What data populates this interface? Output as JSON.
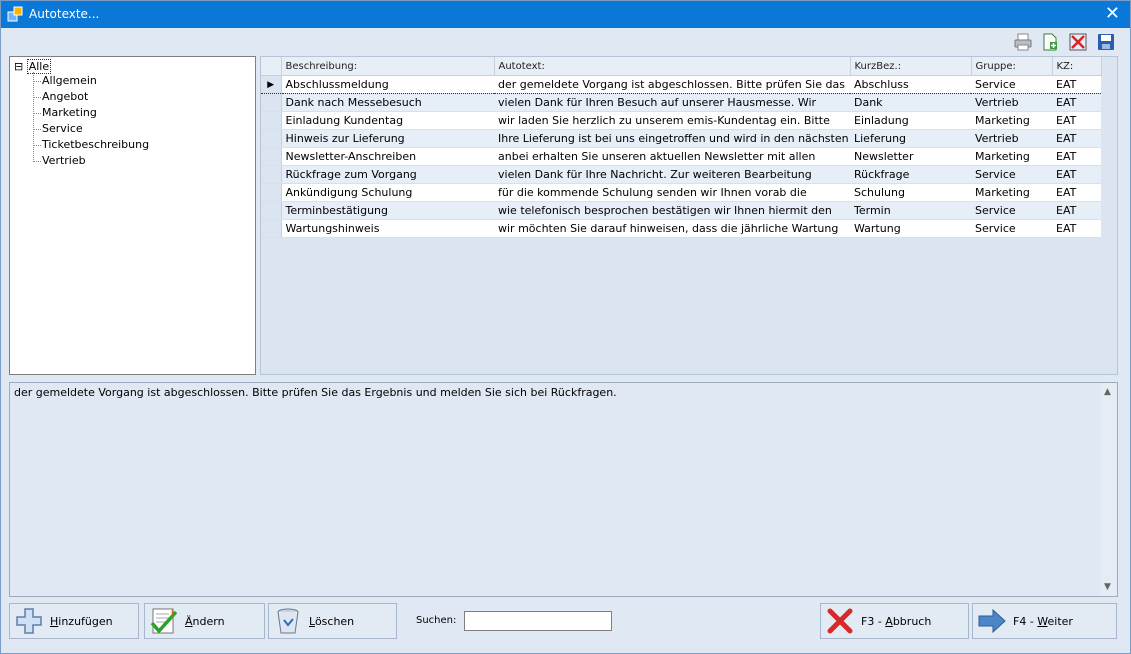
{
  "window": {
    "title": "Autotexte...",
    "close_glyph": "✕"
  },
  "toolbar": {
    "icons": [
      "printer-icon",
      "new-document-icon",
      "delete-icon",
      "save-icon"
    ]
  },
  "tree": {
    "root_toggle": "⊟",
    "root_label": "Alle",
    "children": [
      "Allgemein",
      "Angebot",
      "Marketing",
      "Service",
      "Ticketbeschreibung",
      "Vertrieb"
    ]
  },
  "grid": {
    "headers": [
      "Beschreibung:",
      "Autotext:",
      "KurzBez.:",
      "Gruppe:",
      "KZ:"
    ],
    "current_row_marker": "▶",
    "rows": [
      {
        "beschreibung": "Abschlussmeldung",
        "autotext": "der gemeldete Vorgang ist abgeschlossen. Bitte prüfen Sie das",
        "kurzbez": "Abschluss",
        "gruppe": "Service",
        "kz": "EAT"
      },
      {
        "beschreibung": "Dank nach Messebesuch",
        "autotext": "vielen Dank für Ihren Besuch auf unserer Hausmesse. Wir",
        "kurzbez": "Dank",
        "gruppe": "Vertrieb",
        "kz": "EAT"
      },
      {
        "beschreibung": "Einladung Kundentag",
        "autotext": "wir laden Sie herzlich zu unserem emis-Kundentag ein. Bitte",
        "kurzbez": "Einladung",
        "gruppe": "Marketing",
        "kz": "EAT"
      },
      {
        "beschreibung": "Hinweis zur Lieferung",
        "autotext": "Ihre Lieferung ist bei uns eingetroffen und wird in den nächsten",
        "kurzbez": "Lieferung",
        "gruppe": "Vertrieb",
        "kz": "EAT"
      },
      {
        "beschreibung": "Newsletter-Anschreiben",
        "autotext": "anbei erhalten Sie unseren aktuellen Newsletter mit allen",
        "kurzbez": "Newsletter",
        "gruppe": "Marketing",
        "kz": "EAT"
      },
      {
        "beschreibung": "Rückfrage zum Vorgang",
        "autotext": "vielen Dank für Ihre Nachricht. Zur weiteren Bearbeitung",
        "kurzbez": "Rückfrage",
        "gruppe": "Service",
        "kz": "EAT"
      },
      {
        "beschreibung": "Ankündigung Schulung",
        "autotext": "für die kommende Schulung senden wir Ihnen vorab die",
        "kurzbez": "Schulung",
        "gruppe": "Marketing",
        "kz": "EAT"
      },
      {
        "beschreibung": "Terminbestätigung",
        "autotext": "wie telefonisch besprochen bestätigen wir Ihnen hiermit den",
        "kurzbez": "Termin",
        "gruppe": "Service",
        "kz": "EAT"
      },
      {
        "beschreibung": "Wartungshinweis",
        "autotext": "wir möchten Sie darauf hinweisen, dass die jährliche Wartung",
        "kurzbez": "Wartung",
        "gruppe": "Service",
        "kz": "EAT"
      }
    ]
  },
  "preview": {
    "text": "der gemeldete Vorgang ist abgeschlossen. Bitte prüfen Sie das Ergebnis und melden Sie sich bei Rückfragen.",
    "scroll_up": "▲",
    "scroll_down": "▼"
  },
  "buttons": {
    "add": {
      "accel": "H",
      "rest": "inzufügen"
    },
    "edit": {
      "accel": "Ä",
      "rest": "ndern"
    },
    "delete": {
      "accel": "L",
      "rest": "öschen"
    },
    "cancel": {
      "prefix": "F3 - ",
      "accel": "A",
      "rest": "bbruch"
    },
    "next": {
      "prefix": "F4 - ",
      "accel": "W",
      "rest": "eiter"
    }
  },
  "search": {
    "label": "Suchen:",
    "value": ""
  }
}
